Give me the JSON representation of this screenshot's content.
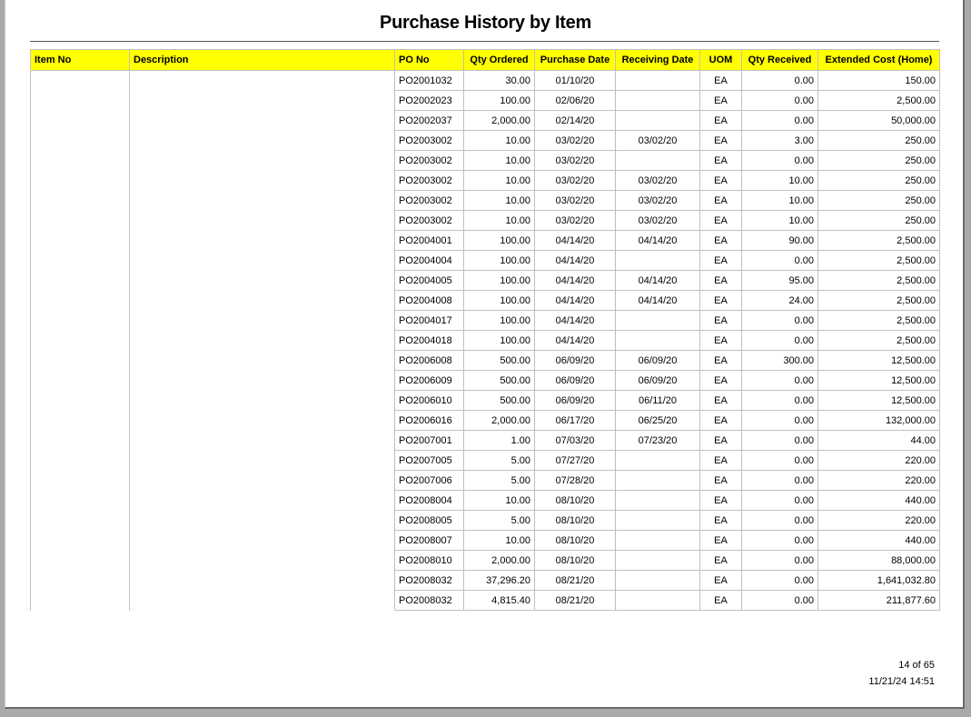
{
  "report": {
    "title": "Purchase History by Item"
  },
  "columns": [
    "Item No",
    "Description",
    "PO No",
    "Qty Ordered",
    "Purchase Date",
    "Receiving Date",
    "UOM",
    "Qty Received",
    "Extended Cost (Home)"
  ],
  "rows": [
    {
      "po": "PO2001032",
      "qty_ordered": "30.00",
      "purchase_date": "01/10/20",
      "receiving_date": "",
      "uom": "EA",
      "qty_received": "0.00",
      "ext_cost": "150.00"
    },
    {
      "po": "PO2002023",
      "qty_ordered": "100.00",
      "purchase_date": "02/06/20",
      "receiving_date": "",
      "uom": "EA",
      "qty_received": "0.00",
      "ext_cost": "2,500.00"
    },
    {
      "po": "PO2002037",
      "qty_ordered": "2,000.00",
      "purchase_date": "02/14/20",
      "receiving_date": "",
      "uom": "EA",
      "qty_received": "0.00",
      "ext_cost": "50,000.00"
    },
    {
      "po": "PO2003002",
      "qty_ordered": "10.00",
      "purchase_date": "03/02/20",
      "receiving_date": "03/02/20",
      "uom": "EA",
      "qty_received": "3.00",
      "ext_cost": "250.00"
    },
    {
      "po": "PO2003002",
      "qty_ordered": "10.00",
      "purchase_date": "03/02/20",
      "receiving_date": "",
      "uom": "EA",
      "qty_received": "0.00",
      "ext_cost": "250.00"
    },
    {
      "po": "PO2003002",
      "qty_ordered": "10.00",
      "purchase_date": "03/02/20",
      "receiving_date": "03/02/20",
      "uom": "EA",
      "qty_received": "10.00",
      "ext_cost": "250.00"
    },
    {
      "po": "PO2003002",
      "qty_ordered": "10.00",
      "purchase_date": "03/02/20",
      "receiving_date": "03/02/20",
      "uom": "EA",
      "qty_received": "10.00",
      "ext_cost": "250.00"
    },
    {
      "po": "PO2003002",
      "qty_ordered": "10.00",
      "purchase_date": "03/02/20",
      "receiving_date": "03/02/20",
      "uom": "EA",
      "qty_received": "10.00",
      "ext_cost": "250.00"
    },
    {
      "po": "PO2004001",
      "qty_ordered": "100.00",
      "purchase_date": "04/14/20",
      "receiving_date": "04/14/20",
      "uom": "EA",
      "qty_received": "90.00",
      "ext_cost": "2,500.00"
    },
    {
      "po": "PO2004004",
      "qty_ordered": "100.00",
      "purchase_date": "04/14/20",
      "receiving_date": "",
      "uom": "EA",
      "qty_received": "0.00",
      "ext_cost": "2,500.00"
    },
    {
      "po": "PO2004005",
      "qty_ordered": "100.00",
      "purchase_date": "04/14/20",
      "receiving_date": "04/14/20",
      "uom": "EA",
      "qty_received": "95.00",
      "ext_cost": "2,500.00"
    },
    {
      "po": "PO2004008",
      "qty_ordered": "100.00",
      "purchase_date": "04/14/20",
      "receiving_date": "04/14/20",
      "uom": "EA",
      "qty_received": "24.00",
      "ext_cost": "2,500.00"
    },
    {
      "po": "PO2004017",
      "qty_ordered": "100.00",
      "purchase_date": "04/14/20",
      "receiving_date": "",
      "uom": "EA",
      "qty_received": "0.00",
      "ext_cost": "2,500.00"
    },
    {
      "po": "PO2004018",
      "qty_ordered": "100.00",
      "purchase_date": "04/14/20",
      "receiving_date": "",
      "uom": "EA",
      "qty_received": "0.00",
      "ext_cost": "2,500.00"
    },
    {
      "po": "PO2006008",
      "qty_ordered": "500.00",
      "purchase_date": "06/09/20",
      "receiving_date": "06/09/20",
      "uom": "EA",
      "qty_received": "300.00",
      "ext_cost": "12,500.00"
    },
    {
      "po": "PO2006009",
      "qty_ordered": "500.00",
      "purchase_date": "06/09/20",
      "receiving_date": "06/09/20",
      "uom": "EA",
      "qty_received": "0.00",
      "ext_cost": "12,500.00"
    },
    {
      "po": "PO2006010",
      "qty_ordered": "500.00",
      "purchase_date": "06/09/20",
      "receiving_date": "06/11/20",
      "uom": "EA",
      "qty_received": "0.00",
      "ext_cost": "12,500.00"
    },
    {
      "po": "PO2006016",
      "qty_ordered": "2,000.00",
      "purchase_date": "06/17/20",
      "receiving_date": "06/25/20",
      "uom": "EA",
      "qty_received": "0.00",
      "ext_cost": "132,000.00"
    },
    {
      "po": "PO2007001",
      "qty_ordered": "1.00",
      "purchase_date": "07/03/20",
      "receiving_date": "07/23/20",
      "uom": "EA",
      "qty_received": "0.00",
      "ext_cost": "44.00"
    },
    {
      "po": "PO2007005",
      "qty_ordered": "5.00",
      "purchase_date": "07/27/20",
      "receiving_date": "",
      "uom": "EA",
      "qty_received": "0.00",
      "ext_cost": "220.00"
    },
    {
      "po": "PO2007006",
      "qty_ordered": "5.00",
      "purchase_date": "07/28/20",
      "receiving_date": "",
      "uom": "EA",
      "qty_received": "0.00",
      "ext_cost": "220.00"
    },
    {
      "po": "PO2008004",
      "qty_ordered": "10.00",
      "purchase_date": "08/10/20",
      "receiving_date": "",
      "uom": "EA",
      "qty_received": "0.00",
      "ext_cost": "440.00"
    },
    {
      "po": "PO2008005",
      "qty_ordered": "5.00",
      "purchase_date": "08/10/20",
      "receiving_date": "",
      "uom": "EA",
      "qty_received": "0.00",
      "ext_cost": "220.00"
    },
    {
      "po": "PO2008007",
      "qty_ordered": "10.00",
      "purchase_date": "08/10/20",
      "receiving_date": "",
      "uom": "EA",
      "qty_received": "0.00",
      "ext_cost": "440.00"
    },
    {
      "po": "PO2008010",
      "qty_ordered": "2,000.00",
      "purchase_date": "08/10/20",
      "receiving_date": "",
      "uom": "EA",
      "qty_received": "0.00",
      "ext_cost": "88,000.00"
    },
    {
      "po": "PO2008032",
      "qty_ordered": "37,296.20",
      "purchase_date": "08/21/20",
      "receiving_date": "",
      "uom": "EA",
      "qty_received": "0.00",
      "ext_cost": "1,641,032.80"
    },
    {
      "po": "PO2008032",
      "qty_ordered": "4,815.40",
      "purchase_date": "08/21/20",
      "receiving_date": "",
      "uom": "EA",
      "qty_received": "0.00",
      "ext_cost": "211,877.60"
    }
  ],
  "footer": {
    "page": "14 of 65",
    "printed": "11/21/24 14:51"
  },
  "colors": {
    "header_bg": "#ffff00",
    "grid": "#c0c0c0"
  }
}
